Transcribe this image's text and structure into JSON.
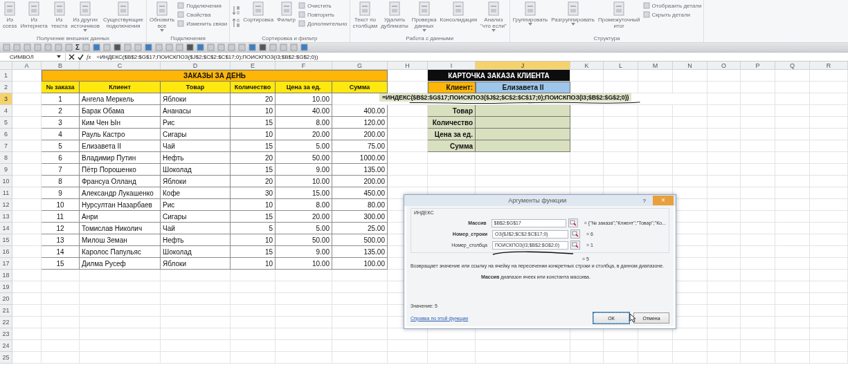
{
  "ribbon": {
    "groups": [
      {
        "label": "Получение внешних данных",
        "items": [
          {
            "kind": "large",
            "lines": [
              "Из",
              "ccess"
            ],
            "dropdown": false
          },
          {
            "kind": "large",
            "lines": [
              "Из",
              "Интернета"
            ],
            "dropdown": false
          },
          {
            "kind": "large",
            "lines": [
              "Из",
              "текста"
            ],
            "dropdown": false
          },
          {
            "kind": "large",
            "lines": [
              "Из других",
              "источников"
            ],
            "dropdown": true
          },
          {
            "kind": "large",
            "lines": [
              "Существующие",
              "подключения"
            ],
            "dropdown": false
          }
        ]
      },
      {
        "label": "Подключения",
        "items": [
          {
            "kind": "large",
            "lines": [
              "Обновить",
              "все"
            ],
            "dropdown": true
          },
          {
            "kind": "stack",
            "labels": [
              "Подключения",
              "Свойства",
              "Изменить связи"
            ]
          }
        ]
      },
      {
        "label": "Сортировка и фильтр",
        "items": [
          {
            "kind": "sort"
          },
          {
            "kind": "large",
            "lines": [
              "Сортировка"
            ],
            "dropdown": false
          },
          {
            "kind": "large",
            "lines": [
              "Фильтр"
            ],
            "dropdown": false
          },
          {
            "kind": "stack",
            "labels": [
              "Очистить",
              "Повторить",
              "Дополнительно"
            ]
          }
        ]
      },
      {
        "label": "Работа с данными",
        "items": [
          {
            "kind": "large",
            "lines": [
              "Текст по",
              "столбцам"
            ],
            "dropdown": false
          },
          {
            "kind": "large",
            "lines": [
              "Удалить",
              "дубликаты"
            ],
            "dropdown": false
          },
          {
            "kind": "large",
            "lines": [
              "Проверка",
              "данных"
            ],
            "dropdown": true
          },
          {
            "kind": "large",
            "lines": [
              "Консолидация"
            ],
            "dropdown": false
          },
          {
            "kind": "large",
            "lines": [
              "Анализ",
              "\"что если\""
            ],
            "dropdown": true
          }
        ]
      },
      {
        "label": "Структура",
        "items": [
          {
            "kind": "large",
            "lines": [
              "Группировать"
            ],
            "dropdown": true
          },
          {
            "kind": "large",
            "lines": [
              "Разгруппировать"
            ],
            "dropdown": true
          },
          {
            "kind": "large",
            "lines": [
              "Промежуточный",
              "итог"
            ],
            "dropdown": false
          },
          {
            "kind": "stack",
            "labels": [
              "Отобразить детали",
              "Скрыть детали"
            ]
          }
        ]
      }
    ]
  },
  "quick_toolbar": {
    "sum_symbol": "Σ"
  },
  "formula_bar": {
    "name_box": "СИМВОЛ",
    "function_label": "fx",
    "formula": "=ИНДЕКС($B$2:$G$17;ПОИСКПОЗ($J$2;$C$2:$C$17;0);ПОИСКПОЗ(I3;$B$2:$G$2;0))"
  },
  "columns": [
    {
      "label": "A",
      "selected": false
    },
    {
      "label": "B",
      "selected": false
    },
    {
      "label": "C",
      "selected": false
    },
    {
      "label": "D",
      "selected": false
    },
    {
      "label": "E",
      "selected": false
    },
    {
      "label": "F",
      "selected": false
    },
    {
      "label": "G",
      "selected": false
    },
    {
      "label": "H",
      "selected": false
    },
    {
      "label": "I",
      "selected": false
    },
    {
      "label": "J",
      "selected": true
    },
    {
      "label": "K",
      "selected": false
    },
    {
      "label": "L",
      "selected": false
    },
    {
      "label": "M",
      "selected": false
    },
    {
      "label": "N",
      "selected": false
    },
    {
      "label": "O",
      "selected": false
    },
    {
      "label": "P",
      "selected": false
    },
    {
      "label": "Q",
      "selected": false
    },
    {
      "label": "R",
      "selected": false
    }
  ],
  "rows": [
    {
      "label": "1",
      "selected": false
    },
    {
      "label": "2",
      "selected": false
    },
    {
      "label": "3",
      "selected": true
    },
    {
      "label": "4",
      "selected": false
    },
    {
      "label": "5",
      "selected": false
    },
    {
      "label": "6",
      "selected": false
    },
    {
      "label": "7",
      "selected": false
    },
    {
      "label": "8",
      "selected": false
    },
    {
      "label": "9",
      "selected": false
    },
    {
      "label": "10",
      "selected": false
    },
    {
      "label": "11",
      "selected": false
    },
    {
      "label": "12",
      "selected": false
    },
    {
      "label": "13",
      "selected": false
    },
    {
      "label": "14",
      "selected": false
    },
    {
      "label": "15",
      "selected": false
    },
    {
      "label": "16",
      "selected": false
    },
    {
      "label": "17",
      "selected": false
    },
    {
      "label": "18",
      "selected": false
    },
    {
      "label": "19",
      "selected": false
    },
    {
      "label": "20",
      "selected": false
    },
    {
      "label": "21",
      "selected": false
    },
    {
      "label": "22",
      "selected": false
    },
    {
      "label": "23",
      "selected": false
    },
    {
      "label": "24",
      "selected": false
    },
    {
      "label": "25",
      "selected": false
    }
  ],
  "orders_table": {
    "title": "ЗАКАЗЫ ЗА ДЕНЬ",
    "columns": [
      "№ заказа",
      "Клиент",
      "Товар",
      "Количество",
      "Цена за ед.",
      "Сумма"
    ],
    "rows": [
      [
        "1",
        "Ангела Меркель",
        "Яблоки",
        "20",
        "10.00"
      ],
      [
        "2",
        "Барак Обама",
        "Ананасы",
        "10",
        "40.00",
        "400.00"
      ],
      [
        "3",
        "Ким Чен Ын",
        "Рис",
        "15",
        "8.00",
        "120.00"
      ],
      [
        "4",
        "Рауль Кастро",
        "Сигары",
        "10",
        "20.00",
        "200.00"
      ],
      [
        "5",
        "Елизавета II",
        "Чай",
        "15",
        "5.00",
        "75.00"
      ],
      [
        "6",
        "Владимир Путин",
        "Нефть",
        "20",
        "50.00",
        "1000.00"
      ],
      [
        "7",
        "Пётр Порошенко",
        "Шоколад",
        "15",
        "9.00",
        "135.00"
      ],
      [
        "8",
        "Франсуа Олланд",
        "Яблоки",
        "20",
        "10.00",
        "200.00"
      ],
      [
        "9",
        "Александр Лукашенко",
        "Кофе",
        "30",
        "15.00",
        "450.00"
      ],
      [
        "10",
        "Нурсултан Назарбаев",
        "Рис",
        "10",
        "8.00",
        "80.00"
      ],
      [
        "11",
        "Анри",
        "Сигары",
        "15",
        "20.00",
        "300.00"
      ],
      [
        "12",
        "Томислав Николич",
        "Чай",
        "5",
        "5.00",
        "25.00"
      ],
      [
        "13",
        "Милош Земан",
        "Нефть",
        "10",
        "50.00",
        "500.00"
      ],
      [
        "14",
        "Каролос Папульяс",
        "Шоколад",
        "15",
        "9.00",
        "135.00"
      ],
      [
        "15",
        "Дилма Русеф",
        "Яблоки",
        "10",
        "10.00",
        "100.00"
      ]
    ]
  },
  "order_card": {
    "title": "КАРТОЧКА ЗАКАЗА КЛИЕНТА",
    "client_label": "Клиент:",
    "client_value": "Елизавета II",
    "field_labels": [
      "Товар",
      "Количество",
      "Цена за ед.",
      "Сумма"
    ]
  },
  "cell_editor": {
    "formula": "=ИНДЕКС($B$2:$G$17;ПОИСКПОЗ($J$2;$C$2:$C$17;0);ПОИСКПОЗ(I3;$B$2:$G$2;0))"
  },
  "dialog": {
    "title": "Аргументы функции",
    "help": "?",
    "close": "×",
    "function_name": "ИНДЕКС",
    "arguments": [
      {
        "label": "Массив",
        "bold": true,
        "value": "$B$2:$G$17",
        "result": "= {\"№ заказа\";\"Клиент\";\"Товар\";\"Ко..."
      },
      {
        "label": "Номер_строки",
        "bold": true,
        "value": "ОЗ($J$2;$C$2:$C$17;0)",
        "result": "= 6"
      },
      {
        "label": "Номер_столбца",
        "bold": false,
        "value": "ПОИСКПОЗ(I3;$B$2:$G$2;0)",
        "result": "= 1"
      }
    ],
    "total": "= 5",
    "description": "Возвращает значение или ссылку на ячейку на пересечении конкретных строки и столбца, в данном диапазоне.",
    "argument_help": "**Массив**   диапазон ячеек или константа массива.",
    "value_line": "Значение:   5",
    "help_link": "Справка по этой функции",
    "ok": "ОК",
    "cancel": "Отмена"
  }
}
